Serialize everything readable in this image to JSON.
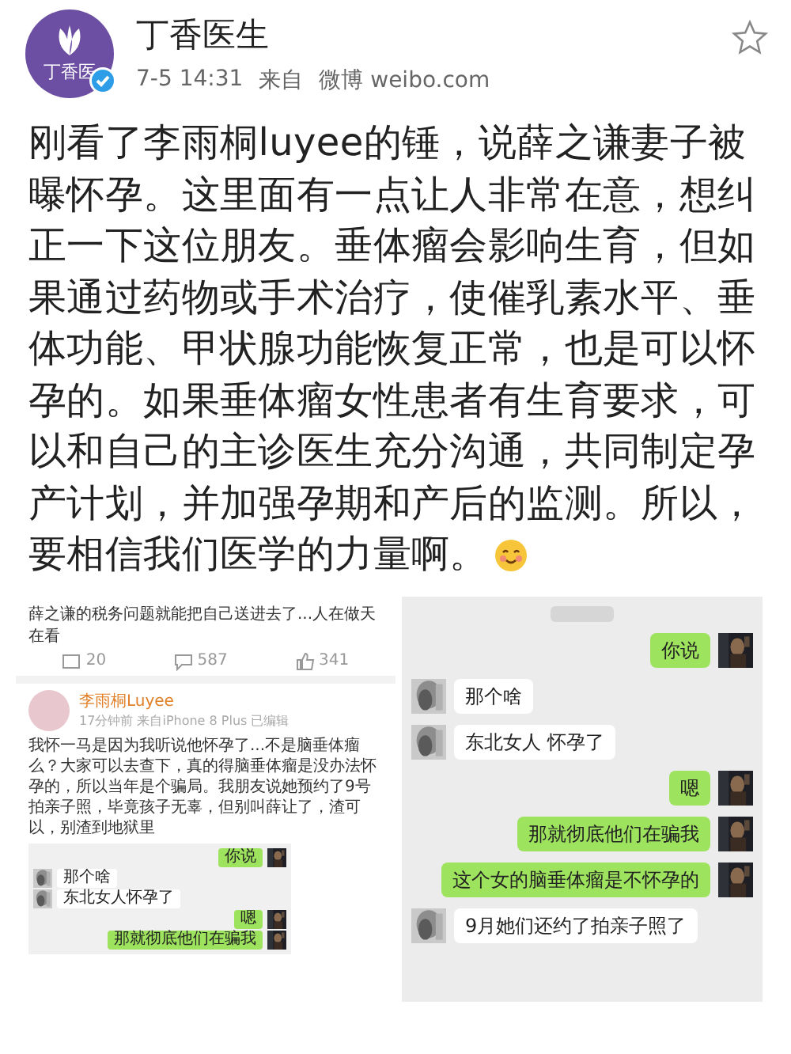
{
  "post": {
    "author": "丁香医生",
    "avatar_label": "丁香医",
    "verified": true,
    "time": "7-5 14:31",
    "source_label": "来自",
    "source": "微博 weibo.com",
    "starred": false,
    "text": "刚看了李雨桐luyee的锤，说薛之谦妻子被曝怀孕。这里面有一点让人非常在意，想纠正一下这位朋友。垂体瘤会影响生育，但如果通过药物或手术治疗，使催乳素水平、垂体功能、甲状腺功能恢复正常，也是可以怀孕的。如果垂体瘤女性患者有生育要求，可以和自己的主诊医生充分沟通，共同制定孕产计划，并加强孕期和产后的监测。所以，要相信我们医学的力量啊。"
  },
  "images": [
    {
      "kind": "weibo",
      "quoted_text": "薛之谦的税务问题就能把自己送进去了...人在做天在看",
      "stats": [
        "20",
        "587",
        "341"
      ],
      "author": "李雨桐Luyee",
      "meta": "17分钟前 来自iPhone 8 Plus 已编辑",
      "text": "我怀一马是因为我听说他怀孕了...不是脑垂体瘤么？大家可以去查下，真的得脑垂体瘤是没办法怀孕的，所以当年是个骗局。我朋友说她预约了9号拍亲子照，毕竟孩子无辜，但别叫薛让了，渣可以，别渣到地狱里",
      "messages": [
        {
          "outgoing": true,
          "text": "你说"
        },
        {
          "outgoing": false,
          "text": "那个啥"
        },
        {
          "outgoing": false,
          "text": "东北女人怀孕了"
        },
        {
          "outgoing": true,
          "text": "嗯"
        },
        {
          "outgoing": true,
          "text": "那就彻底他们在骗我"
        }
      ]
    },
    {
      "kind": "chat",
      "messages": [
        {
          "outgoing": true,
          "text": "你说"
        },
        {
          "outgoing": false,
          "text": "那个啥"
        },
        {
          "outgoing": false,
          "text": "东北女人 怀孕了"
        },
        {
          "outgoing": true,
          "text": "嗯"
        },
        {
          "outgoing": true,
          "text": "那就彻底他们在骗我"
        },
        {
          "outgoing": true,
          "text": "这个女的脑垂体瘤是不怀孕的"
        },
        {
          "outgoing": false,
          "text": "9月她们还约了拍亲子照了"
        }
      ]
    }
  ]
}
